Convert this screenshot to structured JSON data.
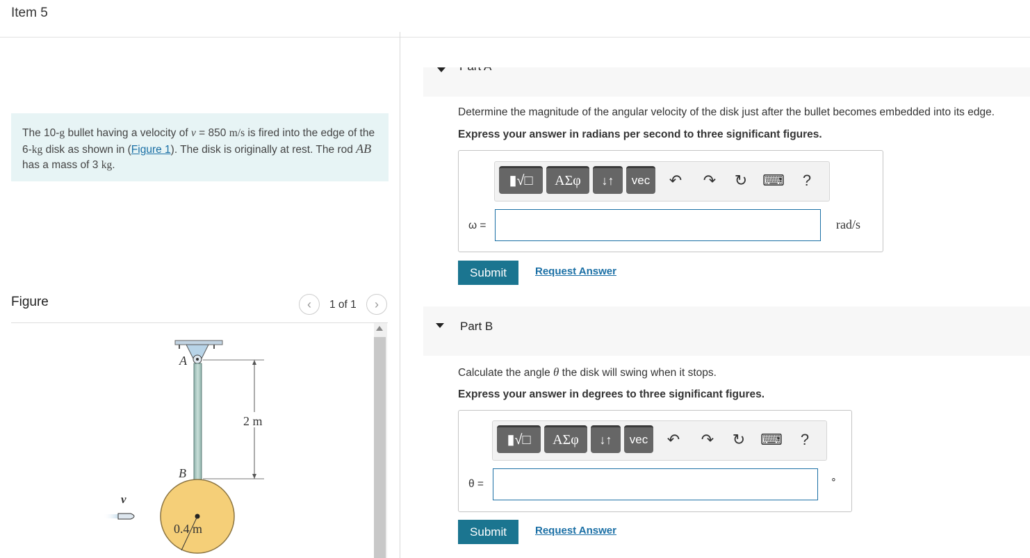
{
  "item": {
    "title": "Item 5"
  },
  "problem": {
    "text_1": "The 10-",
    "g": "g",
    "text_2": " bullet having a velocity of ",
    "v": "v",
    "text_3": " = 850 ",
    "ms": "m/s",
    "text_4": " is fired into the edge of the 6-",
    "kg": "kg",
    "text_5": " disk as shown in (",
    "figure_link": "Figure 1",
    "text_6": "). The disk is originally at rest. The rod ",
    "ab": "AB",
    "text_7": " has a mass of 3 ",
    "kg2": "kg",
    "text_8": "."
  },
  "figure": {
    "heading": "Figure",
    "pager": "1 of 1",
    "prev_icon": "chevron-left-icon",
    "next_icon": "chevron-right-icon",
    "labels": {
      "a": "A",
      "b": "B",
      "v": "v",
      "length": "2 m",
      "radius": "0.4 m"
    }
  },
  "toolbar": {
    "templates": "▮√□",
    "symbols": "ΑΣφ",
    "arrows": "↓↑",
    "vec": "vec",
    "undo": "↶",
    "redo": "↷",
    "reset": "↻",
    "keyboard": "⌨",
    "help": "?"
  },
  "part_a": {
    "label": "Part A",
    "question": "Determine the magnitude of the angular velocity of the disk just after the bullet becomes embedded into its edge.",
    "instruction": "Express your answer in radians per second to three significant figures.",
    "variable": "ω =",
    "unit": "rad/s",
    "submit": "Submit",
    "request": "Request Answer"
  },
  "part_b": {
    "label": "Part B",
    "question_1": "Calculate the angle ",
    "theta": "θ",
    "question_2": " the disk will swing when it stops.",
    "instruction": "Express your answer in degrees to three significant figures.",
    "variable": "θ =",
    "unit": "∘",
    "submit": "Submit",
    "request": "Request Answer"
  },
  "colors": {
    "accent": "#1b7590",
    "link": "#1a6fa5",
    "problem_bg": "#e7f4f5",
    "disk": "#f5cf78"
  }
}
